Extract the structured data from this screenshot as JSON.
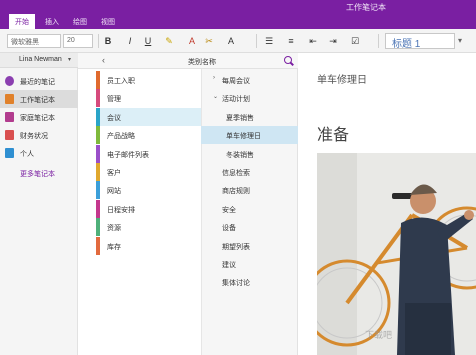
{
  "app": {
    "title": "工作笔记本"
  },
  "tabs": [
    "开始",
    "插入",
    "绘图",
    "视图"
  ],
  "ribbon": {
    "font_name": "微软雅黑",
    "font_size": "20",
    "style_value": "标题 1",
    "buttons": [
      {
        "icon": "bold-icon",
        "glyph": "B"
      },
      {
        "icon": "italic-icon",
        "glyph": "I"
      },
      {
        "icon": "underline-icon",
        "glyph": "U"
      },
      {
        "icon": "highlight-icon",
        "glyph": "✎"
      },
      {
        "icon": "font-color-icon",
        "glyph": "A"
      },
      {
        "icon": "clear-format-icon",
        "glyph": "✂"
      },
      {
        "icon": "text-style-icon",
        "glyph": "A"
      },
      {
        "icon": "bullet-list-icon",
        "glyph": "☰"
      },
      {
        "icon": "numbered-list-icon",
        "glyph": "≡"
      },
      {
        "icon": "outdent-icon",
        "glyph": "⇤"
      },
      {
        "icon": "indent-icon",
        "glyph": "⇥"
      },
      {
        "icon": "checkbox-icon",
        "glyph": "☑"
      }
    ]
  },
  "colors": {
    "brand": "#7a1fa2",
    "notebooks": [
      "#8b3fb0",
      "#e0812b",
      "#b23c8e",
      "#d94f4f",
      "#2f8fd1"
    ],
    "sections": [
      "#e06a2e",
      "#d64a7c",
      "#2aa4c8",
      "#7fba3c",
      "#9a4fc9",
      "#e0a82e",
      "#3c9fd9",
      "#c4378d",
      "#4fb07a",
      "#e26a3e",
      "#5a6fd0"
    ]
  },
  "notebook_pane": {
    "user": "Lina Newman",
    "notebooks": [
      {
        "label": "最近的笔记",
        "icon": "recent-notes-icon"
      },
      {
        "label": "工作笔记本",
        "icon": "notebook-icon"
      },
      {
        "label": "家庭笔记本",
        "icon": "notebook-icon"
      },
      {
        "label": "财务状况",
        "icon": "notebook-icon"
      },
      {
        "label": "个人",
        "icon": "notebook-icon"
      }
    ],
    "more": "更多笔记本"
  },
  "section_pane": {
    "title": "类别名称",
    "sections": [
      "员工入职",
      "管理",
      "会议",
      "产品战略",
      "电子邮件列表",
      "客户",
      "网站",
      "日程安排",
      "资源",
      "库存"
    ]
  },
  "page_pane": {
    "pages": [
      {
        "label": "每周会议",
        "level": 0,
        "expanded": false
      },
      {
        "label": "活动计划",
        "level": 0,
        "expanded": true
      },
      {
        "label": "夏季销售",
        "level": 1
      },
      {
        "label": "单车修理日",
        "level": 1
      },
      {
        "label": "冬装销售",
        "level": 1
      },
      {
        "label": "信息检索",
        "level": 0
      },
      {
        "label": "商店规则",
        "level": 0
      },
      {
        "label": "安全",
        "level": 0
      },
      {
        "label": "设备",
        "level": 0
      },
      {
        "label": "期望列表",
        "level": 0
      },
      {
        "label": "建议",
        "level": 0
      },
      {
        "label": "集体讨论",
        "level": 0
      }
    ]
  },
  "content": {
    "title": "单车修理日",
    "heading": "准备"
  },
  "watermark": "下载吧"
}
